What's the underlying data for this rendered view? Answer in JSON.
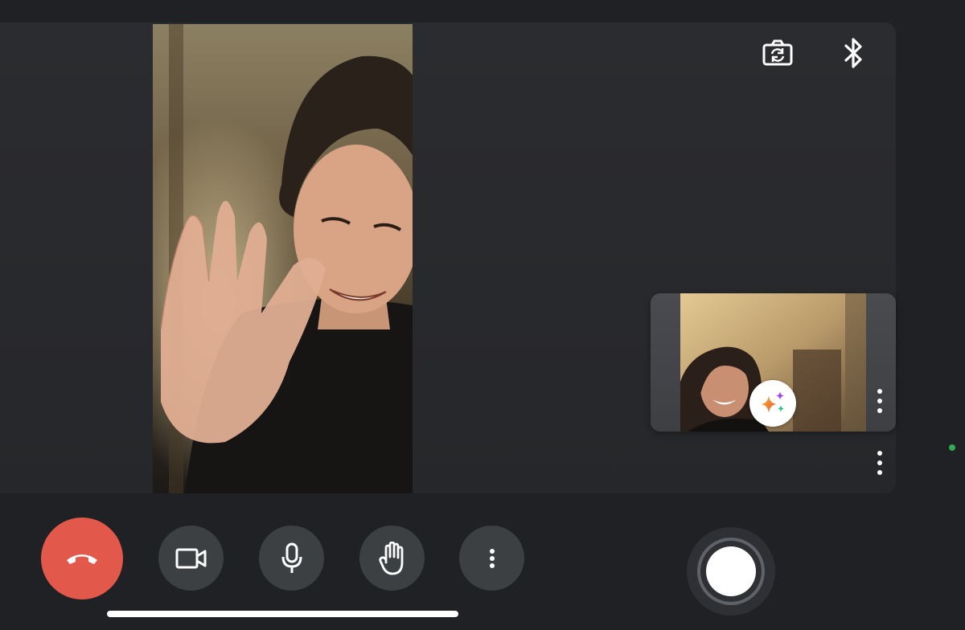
{
  "call": {
    "remote_participant_video": "remote-participant-video",
    "self_view_video": "self-view-video"
  },
  "top_bar": {
    "flip_camera_icon": "camera-flip-icon",
    "bluetooth_icon": "bluetooth-icon"
  },
  "self_tile": {
    "effects_icon": "sparkle-effects-icon",
    "more_icon": "more-vert-icon"
  },
  "stage": {
    "more_icon": "more-vert-icon",
    "status_color": "#34a853"
  },
  "controls": {
    "end_call_icon": "phone-hangup-icon",
    "end_call_color": "#e2584b",
    "camera_icon": "videocam-icon",
    "mic_icon": "mic-icon",
    "hand_icon": "raise-hand-icon",
    "more_icon": "more-vert-icon",
    "capture_icon": "shutter-button-icon"
  },
  "colors": {
    "background": "#202124",
    "control_button": "#3c4043",
    "accent_red": "#e2584b"
  }
}
